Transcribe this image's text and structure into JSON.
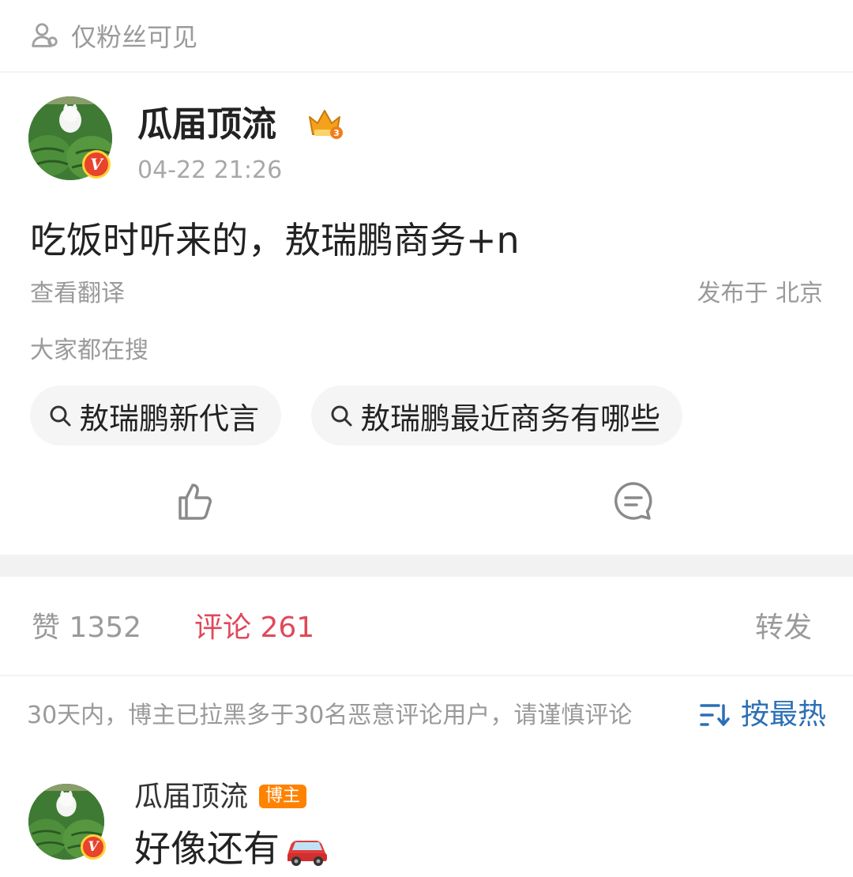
{
  "visibility": {
    "label": "仅粉丝可见",
    "icon": "user-group-icon"
  },
  "post": {
    "author": "瓜届顶流",
    "time": "04-22 21:26",
    "verified_icon": "verified-v-badge-icon",
    "rank_icon": "crown-level-icon",
    "rank_level": "3",
    "content": "吃饭时听来的，敖瑞鹏商务+n",
    "translate": "查看翻译",
    "location": "发布于 北京",
    "search_title": "大家都在搜",
    "search_chips": [
      "敖瑞鹏新代言",
      "敖瑞鹏最近商务有哪些"
    ]
  },
  "actions": {
    "like_icon": "thumb-up-icon",
    "comment_icon": "comment-bubble-icon"
  },
  "tabs": {
    "like": "赞 1352",
    "comment": "评论 261",
    "share": "转发"
  },
  "comments_header": {
    "notice": "30天内，博主已拉黑多于30名恶意评论用户，请谨慎评论",
    "sort": "按最热",
    "sort_icon": "sort-icon"
  },
  "comments": [
    {
      "name": "瓜届顶流",
      "tag": "博主",
      "text": "好像还有",
      "emoji": "car-icon"
    }
  ],
  "colors": {
    "accent_red": "#e0485a",
    "link_blue": "#2c6fb5",
    "tag_orange": "#ff8200"
  }
}
